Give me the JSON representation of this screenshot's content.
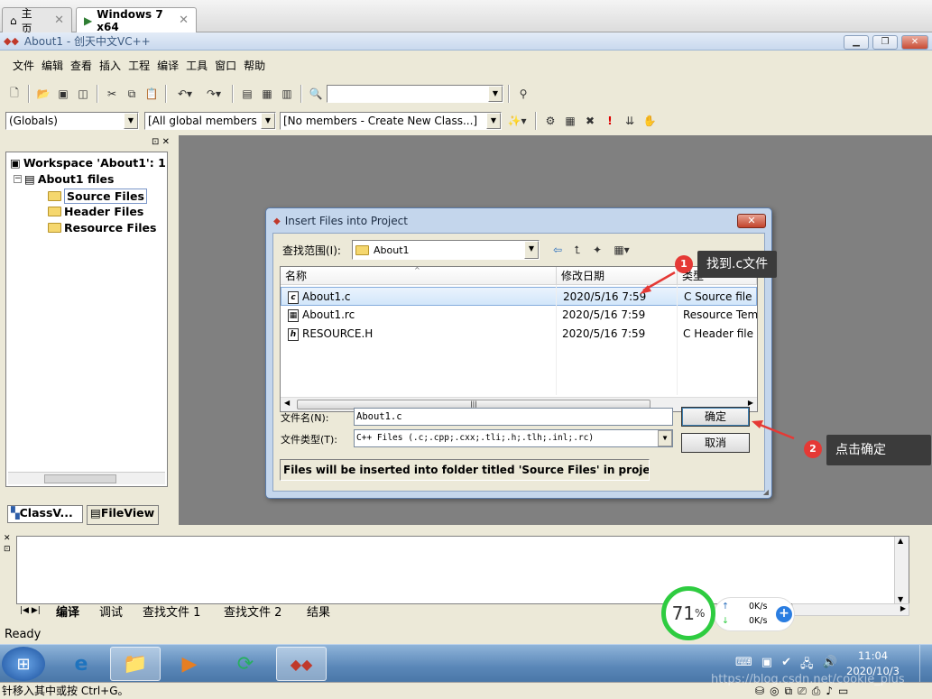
{
  "host_tabs": [
    {
      "label": "主页",
      "icon": "home-icon"
    },
    {
      "label": "Windows 7 x64",
      "icon": "vm-icon"
    }
  ],
  "vc_title": "About1 - 创天中文VC++",
  "menu": [
    "文件",
    "编辑",
    "查看",
    "插入",
    "工程",
    "编译",
    "工具",
    "窗口",
    "帮助"
  ],
  "wizardbar": {
    "class_combo": "(Globals)",
    "filter_combo": "[All global members",
    "members_combo": "[No members - Create New Class...]"
  },
  "workspace": {
    "tree": [
      {
        "label": "Workspace 'About1': 1",
        "level": 0
      },
      {
        "label": "About1 files",
        "level": 1
      },
      {
        "label": "Source Files",
        "level": 2,
        "selected": true
      },
      {
        "label": "Header Files",
        "level": 2
      },
      {
        "label": "Resource Files",
        "level": 2
      }
    ],
    "tabs": [
      "ClassV...",
      "FileView"
    ]
  },
  "dialog": {
    "title": "Insert Files into Project",
    "lookin_label": "查找范围(I):",
    "lookin_value": "About1",
    "columns": [
      "名称",
      "修改日期",
      "类型"
    ],
    "files": [
      {
        "name": "About1.c",
        "date": "2020/5/16 7:59",
        "type": "C Source file",
        "icon": "c",
        "selected": true
      },
      {
        "name": "About1.rc",
        "date": "2020/5/16 7:59",
        "type": "Resource Tem",
        "icon": "rc"
      },
      {
        "name": "RESOURCE.H",
        "date": "2020/5/16 7:59",
        "type": "C Header file",
        "icon": "h"
      }
    ],
    "filename_label": "文件名(N):",
    "filename_value": "About1.c",
    "filetype_label": "文件类型(T):",
    "filetype_value": "C++ Files (.c;.cpp;.cxx;.tli;.h;.tlh;.inl;.rc)",
    "ok_label": "确定",
    "cancel_label": "取消",
    "info": "Files will be inserted into folder titled 'Source Files' in project '"
  },
  "annotations": [
    {
      "num": "1",
      "text": "找到.c文件"
    },
    {
      "num": "2",
      "text": "点击确定"
    }
  ],
  "output_tabs": [
    "编译",
    "调试",
    "查找文件 1",
    "查找文件 2",
    "结果"
  ],
  "status": "Ready",
  "speed_widget": {
    "percent": "71",
    "unit": "%",
    "up": "0K/s",
    "down": "0K/s"
  },
  "clock": {
    "time": "11:04",
    "date": "2020/10/3"
  },
  "bottom_status": "针移入其中或按 Ctrl+G。",
  "watermark": "https://blog.csdn.net/cookie_plus"
}
